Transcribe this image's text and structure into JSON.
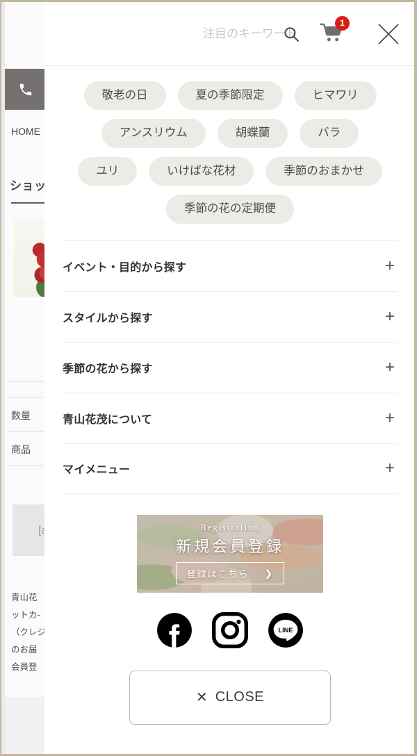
{
  "overlay": {
    "search": {
      "placeholder": "注目のキーワード",
      "value": "",
      "icon": "search-icon"
    },
    "cart": {
      "icon": "shopping-cart-icon",
      "badge_count": "1"
    },
    "close_icon": "close-x-icon",
    "tag_rows": [
      [
        "敬老の日",
        "夏の季節限定",
        "ヒマワリ"
      ],
      [
        "アンスリウム",
        "胡蝶蘭",
        "バラ"
      ],
      [
        "ユリ",
        "いけばな花材",
        "季節のおまかせ"
      ],
      [
        "季節の花の定期便"
      ]
    ],
    "accordion": [
      {
        "label": "イベント・目的から探す",
        "toggle": "+"
      },
      {
        "label": "スタイルから探す",
        "toggle": "+"
      },
      {
        "label": "季節の花から探す",
        "toggle": "+"
      },
      {
        "label": "青山花茂について",
        "toggle": "+"
      },
      {
        "label": "マイメニュー",
        "toggle": "+"
      }
    ],
    "registration_banner": {
      "eyebrow": "Registration",
      "title": "新規会員登録",
      "cta_label": "登録はこちら",
      "cta_chevron": "❯"
    },
    "social": [
      {
        "name": "facebook-icon",
        "label": "Facebook"
      },
      {
        "name": "instagram-icon",
        "label": "Instagram"
      },
      {
        "name": "line-icon",
        "label": "LINE"
      }
    ],
    "close_button": {
      "icon": "✕",
      "label": "CLOSE"
    }
  },
  "background_page": {
    "phone_icon": "phone-icon",
    "breadcrumb": "HOME",
    "section_heading": "ショッ",
    "labels": {
      "quantity": "数量",
      "product": "商品"
    },
    "add_to_cart": "[ad",
    "paragraph_lines": [
      "青山花",
      "ットカ-",
      "（クレジ",
      "のお届",
      "会員登"
    ]
  },
  "colors": {
    "page_border": "#c3b79f",
    "pill_bg": "#ecebe6",
    "badge_red": "#d61f17",
    "phone_box": "#757171",
    "text_primary": "#333333"
  }
}
